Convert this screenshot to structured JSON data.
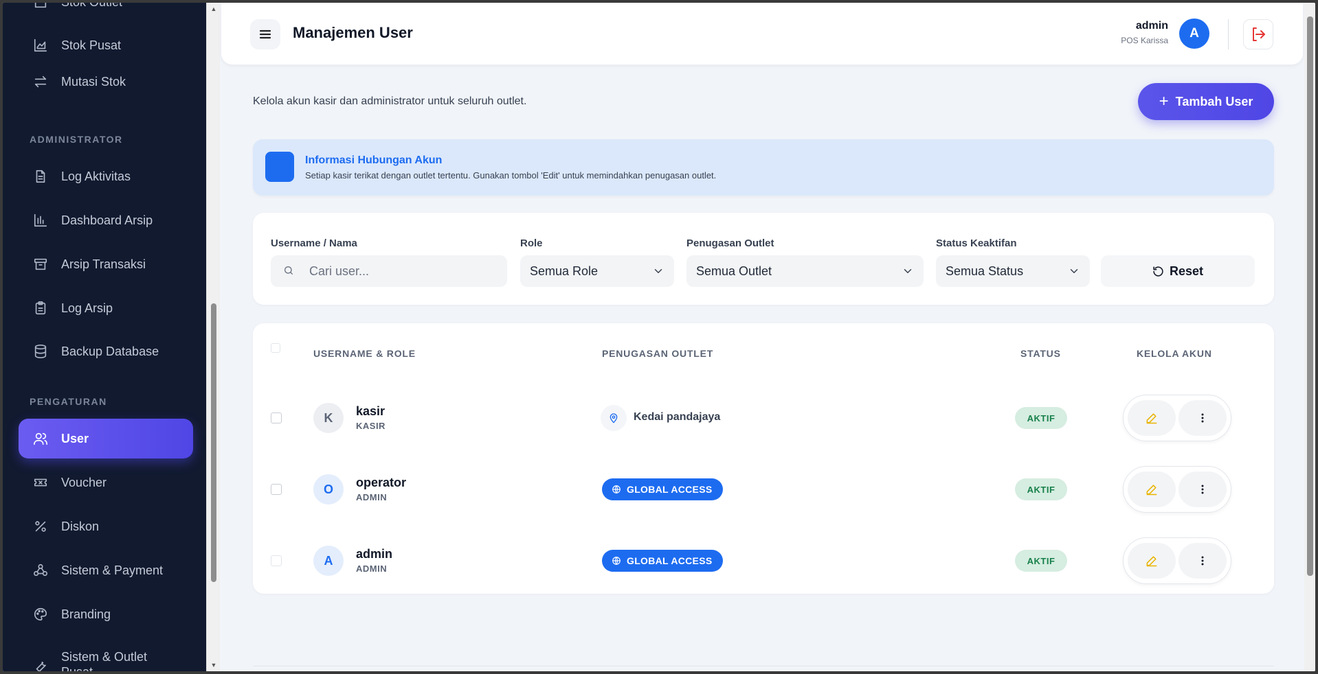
{
  "sidebar": {
    "items_top": [
      {
        "label": "Stok Outlet",
        "icon": "store-icon"
      },
      {
        "label": "Stok Pusat",
        "icon": "chart-area-icon"
      },
      {
        "label": "Mutasi Stok",
        "icon": "arrows-swap-icon"
      }
    ],
    "section_admin": "ADMINISTRATOR",
    "items_admin": [
      {
        "label": "Log Aktivitas",
        "icon": "file-text-icon"
      },
      {
        "label": "Dashboard Arsip",
        "icon": "bar-chart-icon"
      },
      {
        "label": "Arsip Transaksi",
        "icon": "archive-icon"
      },
      {
        "label": "Log Arsip",
        "icon": "clipboard-icon"
      },
      {
        "label": "Backup Database",
        "icon": "database-icon"
      }
    ],
    "section_settings": "PENGATURAN",
    "items_settings": [
      {
        "label": "User",
        "icon": "users-icon",
        "active": true
      },
      {
        "label": "Voucher",
        "icon": "ticket-icon"
      },
      {
        "label": "Diskon",
        "icon": "percent-icon"
      },
      {
        "label": "Sistem & Payment",
        "icon": "webhook-icon"
      },
      {
        "label": "Branding",
        "icon": "palette-icon"
      },
      {
        "label": "Sistem & Outlet Pusat",
        "icon": "wrench-icon"
      }
    ]
  },
  "header": {
    "title": "Manajemen User",
    "user_name": "admin",
    "user_sub": "POS Karissa",
    "avatar_letter": "A"
  },
  "page": {
    "description": "Kelola akun kasir dan administrator untuk seluruh outlet.",
    "add_button": "Tambah User",
    "info_title": "Informasi Hubungan Akun",
    "info_text": "Setiap kasir terikat dengan outlet tertentu. Gunakan tombol 'Edit' untuk memindahkan penugasan outlet."
  },
  "filters": {
    "username_label": "Username / Nama",
    "username_placeholder": "Cari user...",
    "role_label": "Role",
    "role_value": "Semua Role",
    "outlet_label": "Penugasan Outlet",
    "outlet_value": "Semua Outlet",
    "status_label": "Status Keaktifan",
    "status_value": "Semua Status",
    "reset_label": "Reset"
  },
  "table": {
    "headers": {
      "username_role": "USERNAME & ROLE",
      "outlet": "PENUGASAN OUTLET",
      "status": "STATUS",
      "manage": "KELOLA AKUN"
    },
    "rows": [
      {
        "initial": "K",
        "username": "kasir",
        "role": "KASIR",
        "outlet": "Kedai pandajaya",
        "outlet_type": "location",
        "status": "AKTIF"
      },
      {
        "initial": "O",
        "username": "operator",
        "role": "ADMIN",
        "outlet": "GLOBAL ACCESS",
        "outlet_type": "global",
        "status": "AKTIF"
      },
      {
        "initial": "A",
        "username": "admin",
        "role": "ADMIN",
        "outlet": "GLOBAL ACCESS",
        "outlet_type": "global",
        "status": "AKTIF"
      }
    ]
  },
  "colors": {
    "sidebar_bg": "#111a2f",
    "accent": "#4f46e5",
    "primary_blue": "#1d6cf0",
    "status_green": "#17804a",
    "logout_red": "#e53935"
  }
}
